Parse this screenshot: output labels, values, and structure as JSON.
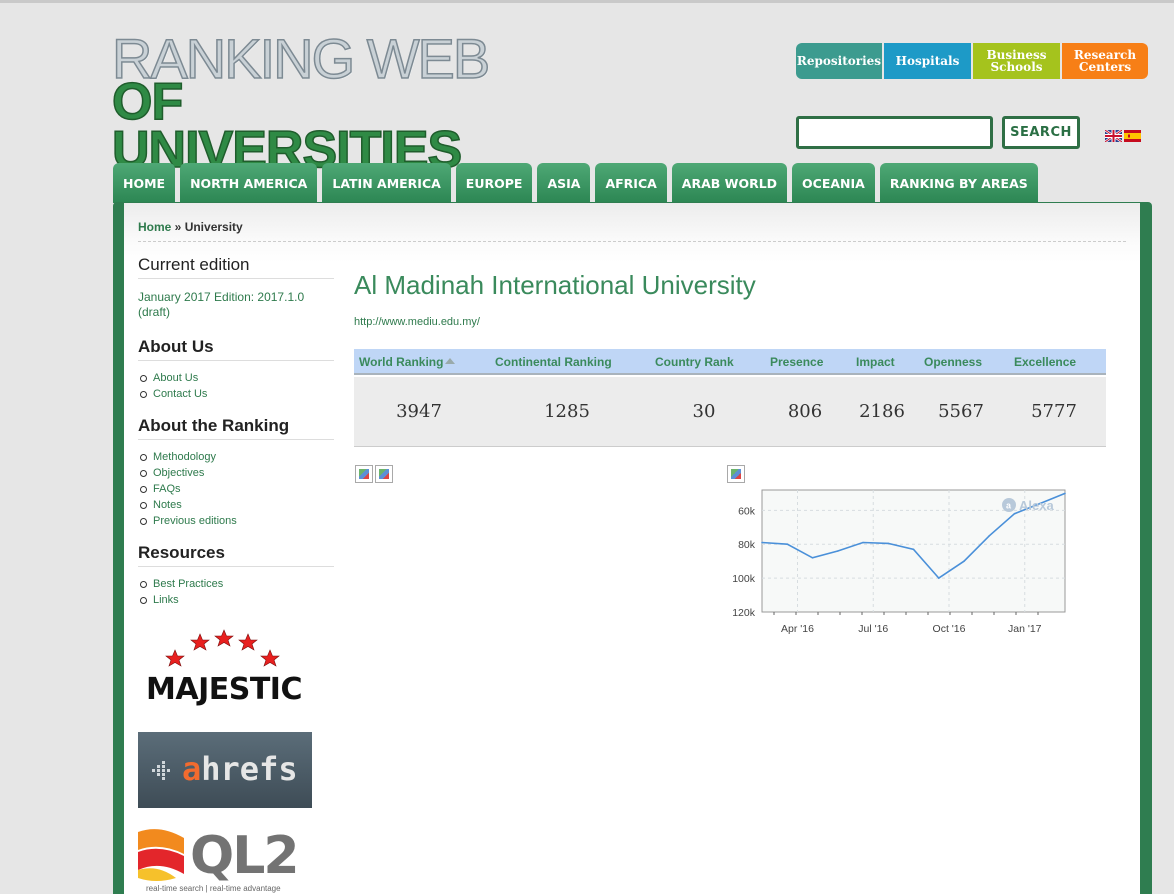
{
  "logo": {
    "line1": "RANKING WEB",
    "line2": "OF UNIVERSITIES"
  },
  "categories": [
    {
      "label": "Repositories"
    },
    {
      "label": "Hospitals"
    },
    {
      "line1": "Business",
      "line2": "Schools"
    },
    {
      "line1": "Research",
      "line2": "Centers"
    }
  ],
  "search": {
    "button": "SEARCH",
    "value": ""
  },
  "nav": [
    "HOME",
    "NORTH AMERICA",
    "LATIN AMERICA",
    "EUROPE",
    "ASIA",
    "AFRICA",
    "ARAB WORLD",
    "OCEANIA",
    "RANKING BY AREAS"
  ],
  "breadcrumb": {
    "home": "Home",
    "sep": " » ",
    "current": "University"
  },
  "sidebar": {
    "current_edition_title": "Current edition",
    "current_edition_text": "January 2017 Edition: 2017.1.0 (draft)",
    "about_us_title": "About Us",
    "about_us_items": [
      "About Us",
      "Contact Us"
    ],
    "about_ranking_title": "About the Ranking",
    "about_ranking_items": [
      "Methodology",
      "Objectives",
      "FAQs",
      "Notes",
      "Previous editions"
    ],
    "resources_title": "Resources",
    "resources_items": [
      "Best Practices",
      "Links"
    ]
  },
  "logos": {
    "majestic": "MAJESTIC",
    "ahrefs_a": "a",
    "ahrefs_rest": "hrefs",
    "ql2": "QL2",
    "ql2_tag": "real-time search | real-time advantage"
  },
  "university": {
    "name": "Al Madinah International University",
    "url": "http://www.mediu.edu.my/"
  },
  "rank_table": {
    "headers": [
      "World Ranking",
      "Continental Ranking",
      "Country Rank",
      "Presence",
      "Impact",
      "Openness",
      "Excellence"
    ],
    "values": [
      "3947",
      "1285",
      "30",
      "806",
      "2186",
      "5567",
      "5777"
    ]
  },
  "alexa_chart": {
    "brand": "Alexa",
    "y_ticks": [
      "60k",
      "80k",
      "100k",
      "120k"
    ],
    "x_ticks": [
      "Apr '16",
      "Jul '16",
      "Oct '16",
      "Jan '17"
    ]
  },
  "chart_data": {
    "type": "line",
    "title": "",
    "xlabel": "",
    "ylabel": "",
    "inverted_y": true,
    "ylim": [
      120000,
      48000
    ],
    "x": [
      "Feb '16",
      "Mar '16",
      "Apr '16",
      "May '16",
      "Jun '16",
      "Jul '16",
      "Aug '16",
      "Sep '16",
      "Oct '16",
      "Nov '16",
      "Dec '16",
      "Jan '17",
      "Feb '17"
    ],
    "series": [
      {
        "values": [
          79000,
          80000,
          88000,
          84000,
          79000,
          79500,
          83000,
          100000,
          90000,
          75000,
          62000,
          56000,
          50000
        ]
      }
    ],
    "colors": {
      "line": "#4a90d9"
    }
  }
}
